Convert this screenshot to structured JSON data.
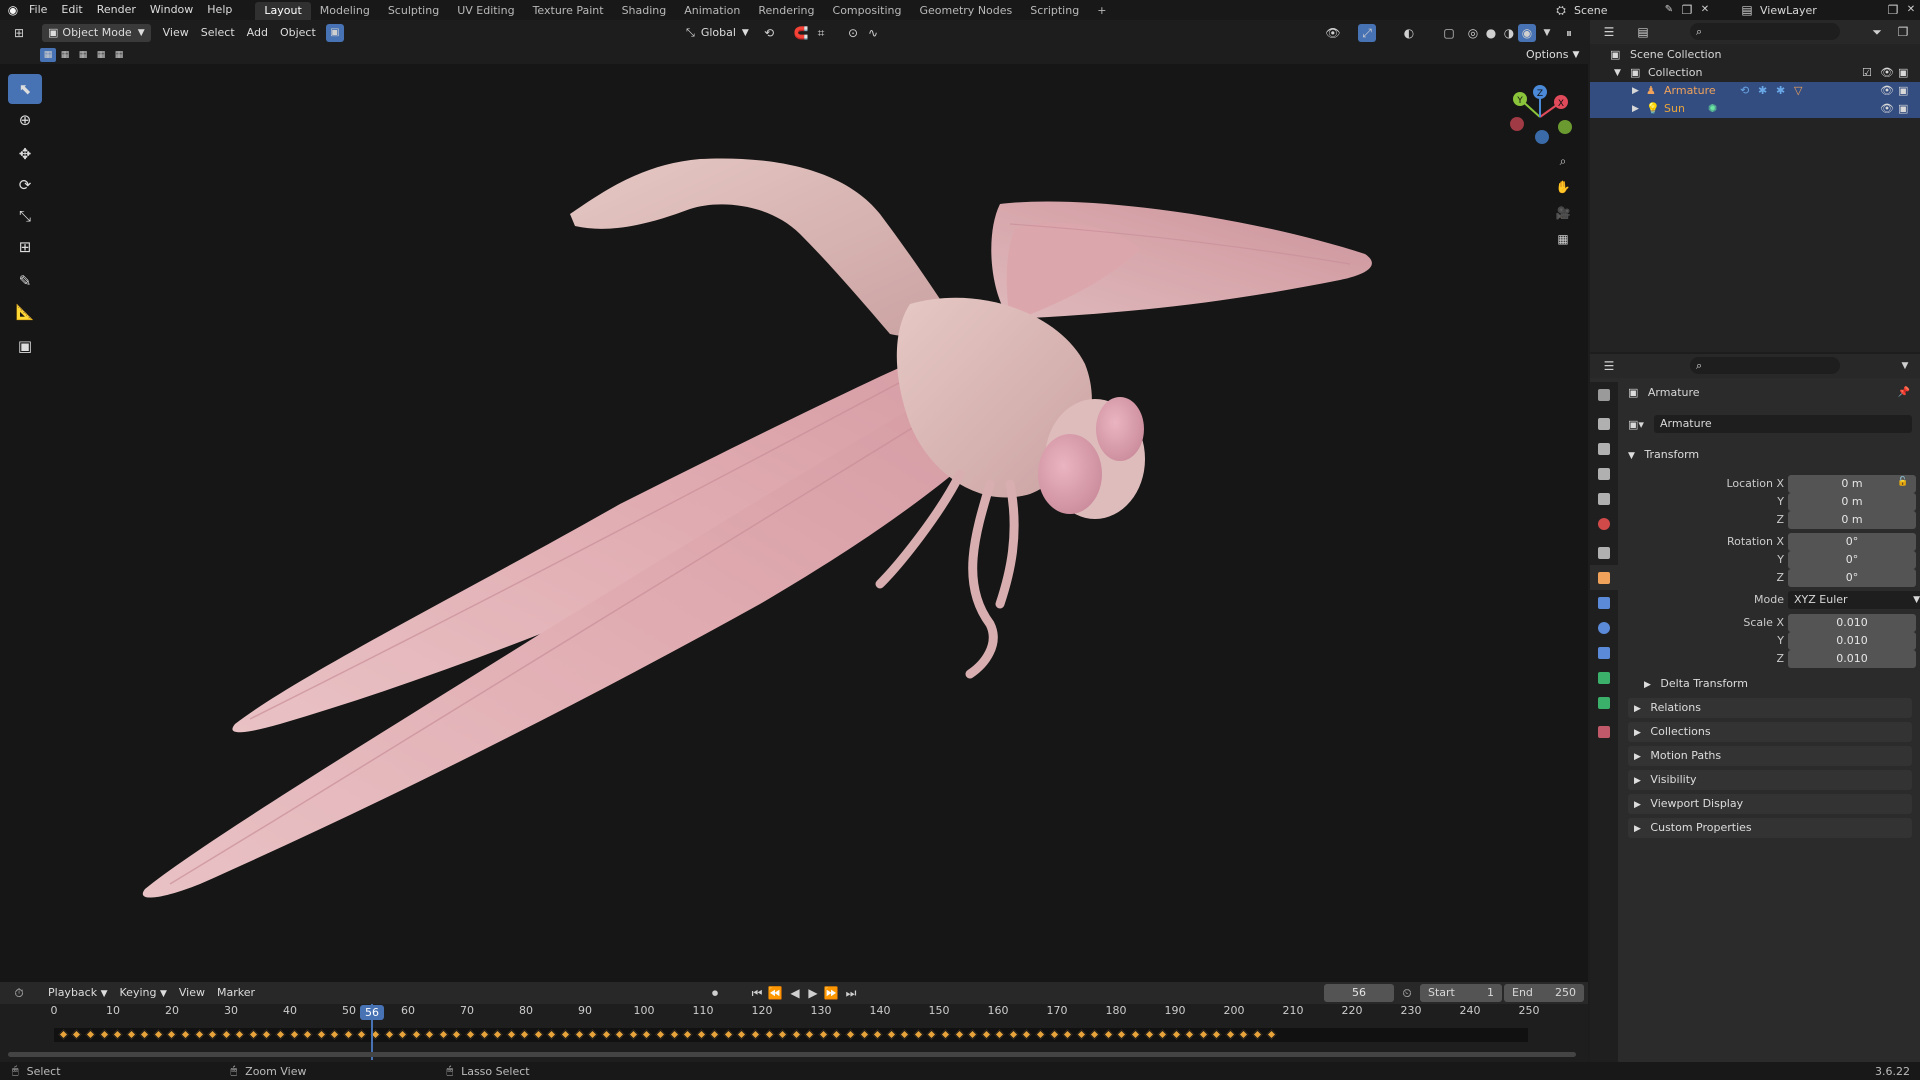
{
  "topbar": {
    "menus": [
      "File",
      "Edit",
      "Render",
      "Window",
      "Help"
    ],
    "workspaces": [
      "Layout",
      "Modeling",
      "Sculpting",
      "UV Editing",
      "Texture Paint",
      "Shading",
      "Animation",
      "Rendering",
      "Compositing",
      "Geometry Nodes",
      "Scripting"
    ],
    "active_workspace": "Layout",
    "add_tab": "+",
    "scene": "Scene",
    "view_layer": "ViewLayer"
  },
  "viewport": {
    "mode": "Object Mode",
    "menus": [
      "View",
      "Select",
      "Add",
      "Object"
    ],
    "orientation": "Global",
    "options": "Options",
    "gizmo": {
      "x": "X",
      "y": "Y",
      "z": "Z"
    }
  },
  "outliner": {
    "scene_collection": "Scene Collection",
    "collection": "Collection",
    "items": [
      {
        "label": "Armature",
        "color": "#f0a25a"
      },
      {
        "label": "Sun",
        "color": "#e8a43a"
      }
    ]
  },
  "properties": {
    "object_name": "Armature",
    "datablock_name": "Armature",
    "transform": {
      "title": "Transform",
      "location_label": "Location X",
      "location": [
        "0 m",
        "0 m",
        "0 m"
      ],
      "rotation_label": "Rotation X",
      "rotation": [
        "0°",
        "0°",
        "0°"
      ],
      "mode_label": "Mode",
      "mode": "XYZ Euler",
      "scale_label": "Scale X",
      "scale": [
        "0.010",
        "0.010",
        "0.010"
      ],
      "y": "Y",
      "z": "Z"
    },
    "delta_transform": "Delta Transform",
    "panels": [
      "Relations",
      "Collections",
      "Motion Paths",
      "Visibility",
      "Viewport Display",
      "Custom Properties"
    ]
  },
  "timeline": {
    "menus": [
      "Playback",
      "Keying",
      "View",
      "Marker"
    ],
    "current_frame": "56",
    "start_label": "Start",
    "start": "1",
    "end_label": "End",
    "end": "250",
    "ticks": [
      "0",
      "10",
      "20",
      "30",
      "40",
      "50",
      "60",
      "70",
      "80",
      "90",
      "100",
      "110",
      "120",
      "130",
      "140",
      "150",
      "160",
      "170",
      "180",
      "190",
      "200",
      "210",
      "220",
      "230",
      "240",
      "250"
    ]
  },
  "statusbar": {
    "select": "Select",
    "zoom_view": "Zoom View",
    "lasso_select": "Lasso Select",
    "version": "3.6.22"
  },
  "colors": {
    "accent": "#4772b3",
    "keyframe": "#e8a43a",
    "object_orange": "#f0a25a",
    "wing": "#e8b8bc"
  }
}
